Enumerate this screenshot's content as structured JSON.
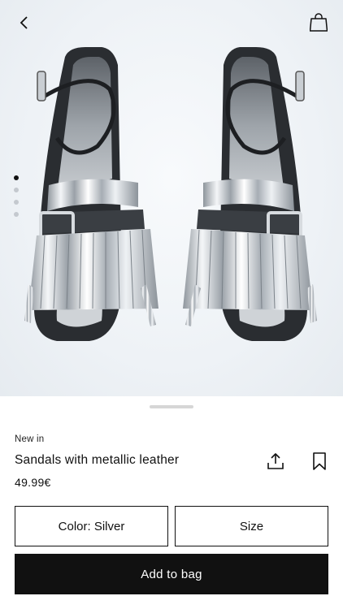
{
  "header": {
    "back_icon": "chevron-left-icon",
    "bag_icon": "shopping-bag-icon"
  },
  "gallery": {
    "image_alt": "Silver metallic fringed sandals",
    "image_count": 4,
    "active_index": 0
  },
  "product": {
    "badge": "New in",
    "name": "Sandals with metallic leather",
    "price": "49.99€",
    "share_icon": "share-icon",
    "save_icon": "bookmark-icon"
  },
  "actions": {
    "color_label": "Color: Silver",
    "size_label": "Size",
    "add_label": "Add to bag"
  },
  "colors": {
    "primary": "#111111",
    "background": "#ffffff",
    "hero_bg": "#eef2f6"
  }
}
